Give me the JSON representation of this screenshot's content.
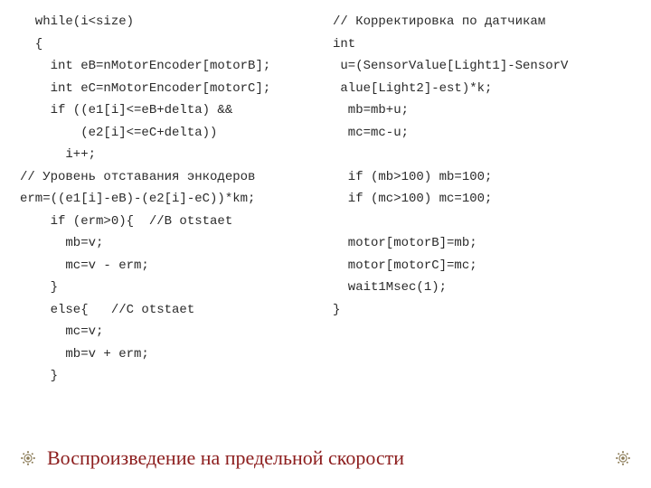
{
  "code_left": "  while(i<size)\n  {\n    int eB=nMotorEncoder[motorB];\n    int eC=nMotorEncoder[motorC];\n    if ((e1[i]<=eB+delta) &&\n        (e2[i]<=eC+delta))\n      i++;\n// Уровень отставания энкодеров\nerm=((e1[i]-eB)-(e2[i]-eC))*km;\n    if (erm>0){  //B otstaet\n      mb=v;\n      mc=v - erm;\n    }\n    else{   //C otstaet\n      mc=v;\n      mb=v + erm;\n    }",
  "code_right": "// Корректировка по датчикам\nint\n u=(SensorValue[Light1]-SensorV\n alue[Light2]-est)*k;\n  mb=mb+u;\n  mc=mc-u;\n\n  if (mb>100) mb=100;\n  if (mc>100) mc=100;\n\n  motor[motorB]=mb;\n  motor[motorC]=mc;\n  wait1Msec(1);\n}",
  "footer_title": "Воспроизведение на предельной скорости",
  "accent_color": "#8c1d1d",
  "medallion_color": "#8a7a55"
}
